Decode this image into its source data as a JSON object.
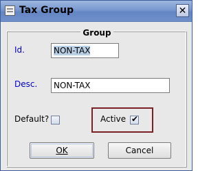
{
  "window": {
    "title": "Tax Group"
  },
  "group": {
    "legend": "Group"
  },
  "fields": {
    "id_label": "Id.",
    "id_value": "NON-TAX",
    "desc_label": "Desc.",
    "desc_value": "NON-TAX",
    "default_label": "Default?",
    "default_checked": false,
    "active_label": "Active",
    "active_checked": true
  },
  "buttons": {
    "ok": "OK",
    "cancel": "Cancel"
  },
  "icons": {
    "app": "app-window-icon",
    "close": "close-icon",
    "check": "checkmark-icon"
  }
}
